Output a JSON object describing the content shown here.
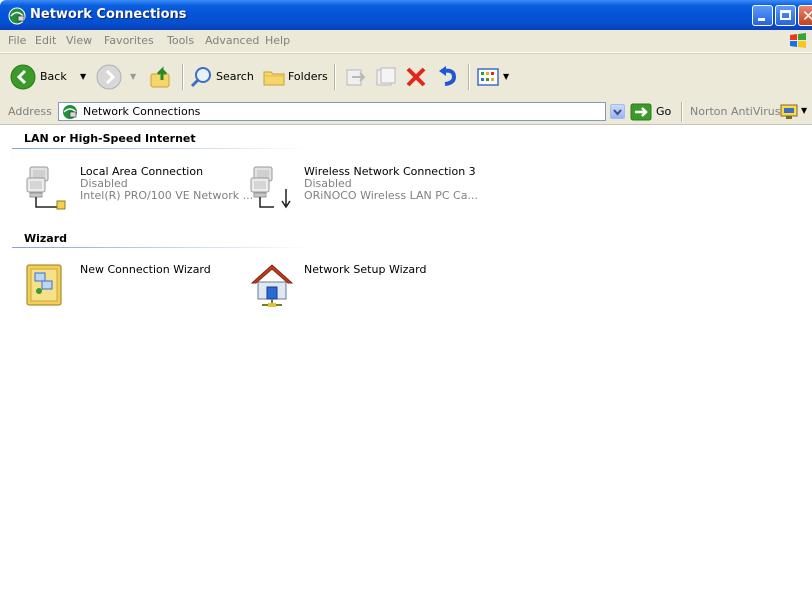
{
  "window": {
    "title": "Network Connections",
    "colors": {
      "titlebar": "#0553d8",
      "chrome": "#ece9d8",
      "close": "#c2411e"
    }
  },
  "menu": [
    "File",
    "Edit",
    "View",
    "Favorites",
    "Tools",
    "Advanced",
    "Help"
  ],
  "toolbar": {
    "back_label": "Back",
    "search_label": "Search",
    "folders_label": "Folders"
  },
  "address": {
    "label": "Address",
    "value": "Network Connections",
    "go_label": "Go",
    "norton_label": "Norton AntiVirus"
  },
  "groups": [
    {
      "title": "LAN or High-Speed Internet",
      "items": [
        {
          "name": "Local Area Connection",
          "status": "Disabled",
          "device": "Intel(R) PRO/100 VE Network ..."
        },
        {
          "name": "Wireless Network Connection 3",
          "status": "Disabled",
          "device": "ORiNOCO Wireless LAN PC Ca..."
        }
      ]
    },
    {
      "title": "Wizard",
      "items": [
        {
          "name": "New Connection Wizard"
        },
        {
          "name": "Network Setup Wizard"
        }
      ]
    }
  ]
}
